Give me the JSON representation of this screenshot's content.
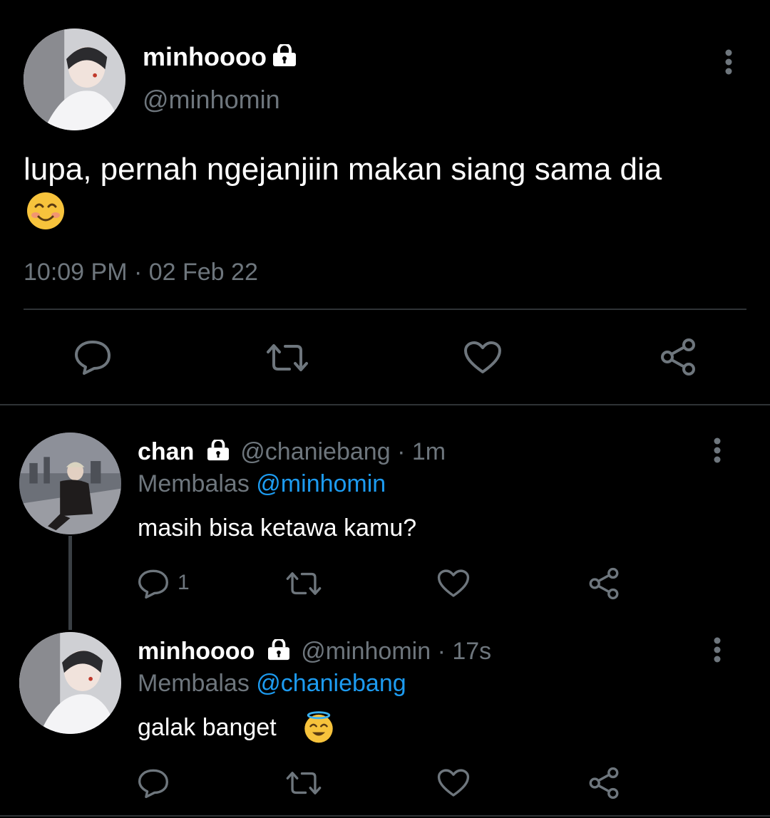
{
  "main_tweet": {
    "display_name": "minhoooo",
    "handle": "@minhomin",
    "text": "lupa, pernah ngejanjiin makan siang sama dia",
    "timestamp": "10:09 PM · 02 Feb 22"
  },
  "replies": [
    {
      "display_name": "chan",
      "handle": "@chaniebang",
      "time": "· 1m",
      "replying_prefix": "Membalas",
      "replying_to": "@minhomin",
      "text": "masih bisa ketawa kamu?",
      "reply_count": "1"
    },
    {
      "display_name": "minhoooo",
      "handle": "@minhomin",
      "time": "· 17s",
      "replying_prefix": "Membalas",
      "replying_to": "@chaniebang",
      "text": "galak banget"
    }
  ],
  "icons": {
    "reply": "reply-icon",
    "retweet": "retweet-icon",
    "like": "heart-icon",
    "share": "share-icon",
    "more": "more-icon",
    "lock": "lock-icon"
  },
  "colors": {
    "background": "#000000",
    "text": "#ffffff",
    "muted": "#6e767d",
    "link": "#1d9bf0",
    "divider": "#2f3336"
  }
}
